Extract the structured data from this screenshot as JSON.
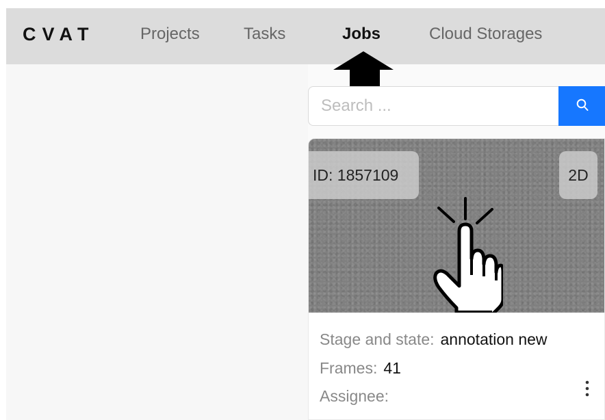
{
  "header": {
    "logo": "CVAT",
    "nav": [
      {
        "label": "Projects"
      },
      {
        "label": "Tasks"
      },
      {
        "label": "Jobs"
      },
      {
        "label": "Cloud Storages"
      }
    ]
  },
  "search": {
    "placeholder": "Search ..."
  },
  "job_card": {
    "id": "ID: 1857109",
    "dimension": "2D",
    "stage_label": "Stage and state",
    "stage_value": "annotation new",
    "frames_label": "Frames",
    "frames_value": "41",
    "assignee_label": "Assignee",
    "assignee_value": ""
  },
  "icons": {
    "arrow": "arrow-up-icon",
    "hand": "pointing-hand-icon",
    "search": "search-icon",
    "more": "more-vertical-icon"
  },
  "colors": {
    "header_bg": "#dcdcdc",
    "accent": "#1677ff",
    "preview_bg": "#808080"
  }
}
